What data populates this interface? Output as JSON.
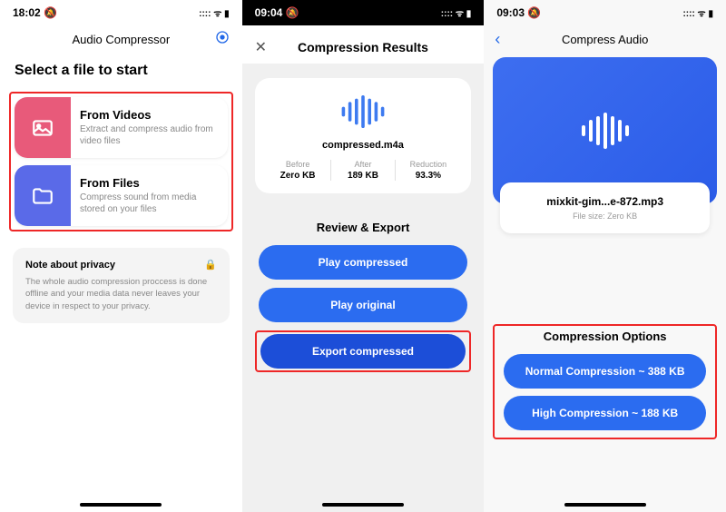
{
  "screen1": {
    "status_time": "18:02",
    "status_bell": "🔕",
    "nav_title": "Audio Compressor",
    "section_title": "Select a file to start",
    "option_videos": {
      "title": "From Videos",
      "desc": "Extract and compress audio from video files"
    },
    "option_files": {
      "title": "From Files",
      "desc": "Compress sound from media stored on your files"
    },
    "privacy": {
      "title": "Note about privacy",
      "text": "The whole audio compression proccess is done offline and your media data never leaves your device in respect to your privacy."
    }
  },
  "screen2": {
    "status_time": "09:04",
    "status_bell": "🔕",
    "nav_title": "Compression Results",
    "filename": "compressed.m4a",
    "stats": {
      "before_label": "Before",
      "before_value": "Zero KB",
      "after_label": "After",
      "after_value": "189 KB",
      "reduction_label": "Reduction",
      "reduction_value": "93.3%"
    },
    "review_title": "Review & Export",
    "btn_play_compressed": "Play compressed",
    "btn_play_original": "Play original",
    "btn_export": "Export compressed"
  },
  "screen3": {
    "status_time": "09:03",
    "status_bell": "🔕",
    "nav_title": "Compress Audio",
    "filename": "mixkit-gim...e-872.mp3",
    "filesize": "File size: Zero KB",
    "comp_title": "Compression Options",
    "btn_normal": "Normal Compression ~ 388 KB",
    "btn_high": "High Compression ~ 188 KB"
  }
}
